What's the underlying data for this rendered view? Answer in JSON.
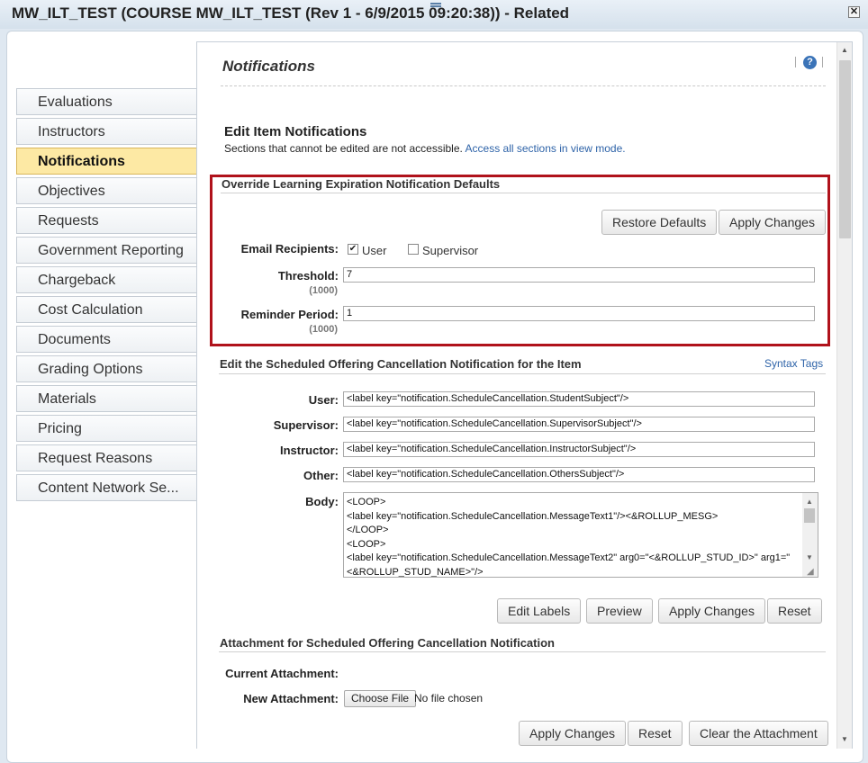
{
  "window": {
    "title": "MW_ILT_TEST (COURSE MW_ILT_TEST (Rev 1 - 6/9/2015 09:20:38)) - Related",
    "close_label": "✕"
  },
  "sidebar": {
    "items": [
      {
        "label": "Evaluations",
        "active": false
      },
      {
        "label": "Instructors",
        "active": false
      },
      {
        "label": "Notifications",
        "active": true
      },
      {
        "label": "Objectives",
        "active": false
      },
      {
        "label": "Requests",
        "active": false
      },
      {
        "label": "Government Reporting",
        "active": false
      },
      {
        "label": "Chargeback",
        "active": false
      },
      {
        "label": "Cost Calculation",
        "active": false
      },
      {
        "label": "Documents",
        "active": false
      },
      {
        "label": "Grading Options",
        "active": false
      },
      {
        "label": "Materials",
        "active": false
      },
      {
        "label": "Pricing",
        "active": false
      },
      {
        "label": "Request Reasons",
        "active": false
      },
      {
        "label": "Content Network Se...",
        "active": false
      }
    ]
  },
  "main": {
    "title": "Notifications",
    "help_icon": "?",
    "edit_heading": "Edit Item Notifications",
    "edit_note": "Sections that cannot be edited are not accessible.",
    "edit_link": "Access all sections in view mode."
  },
  "override": {
    "heading": "Override Learning Expiration Notification Defaults",
    "restore_label": "Restore Defaults",
    "apply_label": "Apply Changes",
    "email_label": "Email Recipients:",
    "user_label": "User",
    "user_checked": true,
    "supervisor_label": "Supervisor",
    "supervisor_checked": false,
    "threshold_label": "Threshold:",
    "threshold_value": "7",
    "threshold_hint": "(1000)",
    "reminder_label": "Reminder Period:",
    "reminder_value": "1",
    "reminder_hint": "(1000)"
  },
  "cancellation": {
    "heading": "Edit the Scheduled Offering Cancellation Notification for the Item",
    "syntax_link": "Syntax Tags",
    "user_label": "User:",
    "user_value": "<label key=\"notification.ScheduleCancellation.StudentSubject\"/>",
    "supervisor_label": "Supervisor:",
    "supervisor_value": "<label key=\"notification.ScheduleCancellation.SupervisorSubject\"/>",
    "instructor_label": "Instructor:",
    "instructor_value": "<label key=\"notification.ScheduleCancellation.InstructorSubject\"/>",
    "other_label": "Other:",
    "other_value": "<label key=\"notification.ScheduleCancellation.OthersSubject\"/>",
    "body_label": "Body:",
    "body_lines": [
      "<LOOP>",
      "<label key=\"notification.ScheduleCancellation.MessageText1\"/><&ROLLUP_MESG>",
      "</LOOP>",
      "<LOOP>",
      "<label key=\"notification.ScheduleCancellation.MessageText2\" arg0=\"<&ROLLUP_STUD_ID>\" arg1=\"",
      "<&ROLLUP_STUD_NAME>\"/>"
    ],
    "edit_labels": "Edit Labels",
    "preview": "Preview",
    "apply": "Apply Changes",
    "reset": "Reset"
  },
  "attachment": {
    "heading": "Attachment for Scheduled Offering Cancellation Notification",
    "current_label": "Current Attachment:",
    "new_label": "New Attachment:",
    "choose_file": "Choose File",
    "no_file": "No file chosen",
    "apply": "Apply Changes",
    "reset": "Reset",
    "clear": "Clear the Attachment"
  }
}
